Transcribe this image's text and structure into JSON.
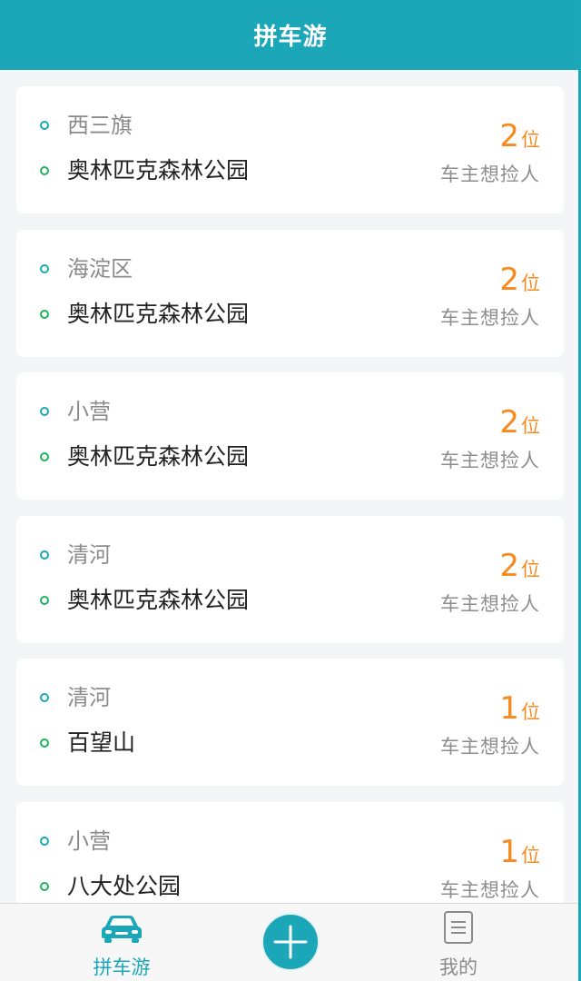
{
  "header": {
    "title": "拼车游"
  },
  "trips": [
    {
      "from": "西三旗",
      "to": "奥林匹克森林公园",
      "seats": "2",
      "seat_unit": "位",
      "note": "车主想捡人"
    },
    {
      "from": "海淀区",
      "to": "奥林匹克森林公园",
      "seats": "2",
      "seat_unit": "位",
      "note": "车主想捡人"
    },
    {
      "from": "小营",
      "to": "奥林匹克森林公园",
      "seats": "2",
      "seat_unit": "位",
      "note": "车主想捡人"
    },
    {
      "from": "清河",
      "to": "奥林匹克森林公园",
      "seats": "2",
      "seat_unit": "位",
      "note": "车主想捡人"
    },
    {
      "from": "清河",
      "to": "百望山",
      "seats": "1",
      "seat_unit": "位",
      "note": "车主想捡人"
    },
    {
      "from": "小营",
      "to": "八大处公园",
      "seats": "1",
      "seat_unit": "位",
      "note": "车主想捡人"
    }
  ],
  "tabbar": {
    "left": {
      "label": "拼车游",
      "icon": "car-icon"
    },
    "center": {
      "icon": "plus-icon"
    },
    "right": {
      "label": "我的",
      "icon": "document-icon"
    }
  },
  "colors": {
    "primary": "#1ca7b8",
    "seat_accent": "#f7891e",
    "destination_dot": "#20b25c"
  }
}
